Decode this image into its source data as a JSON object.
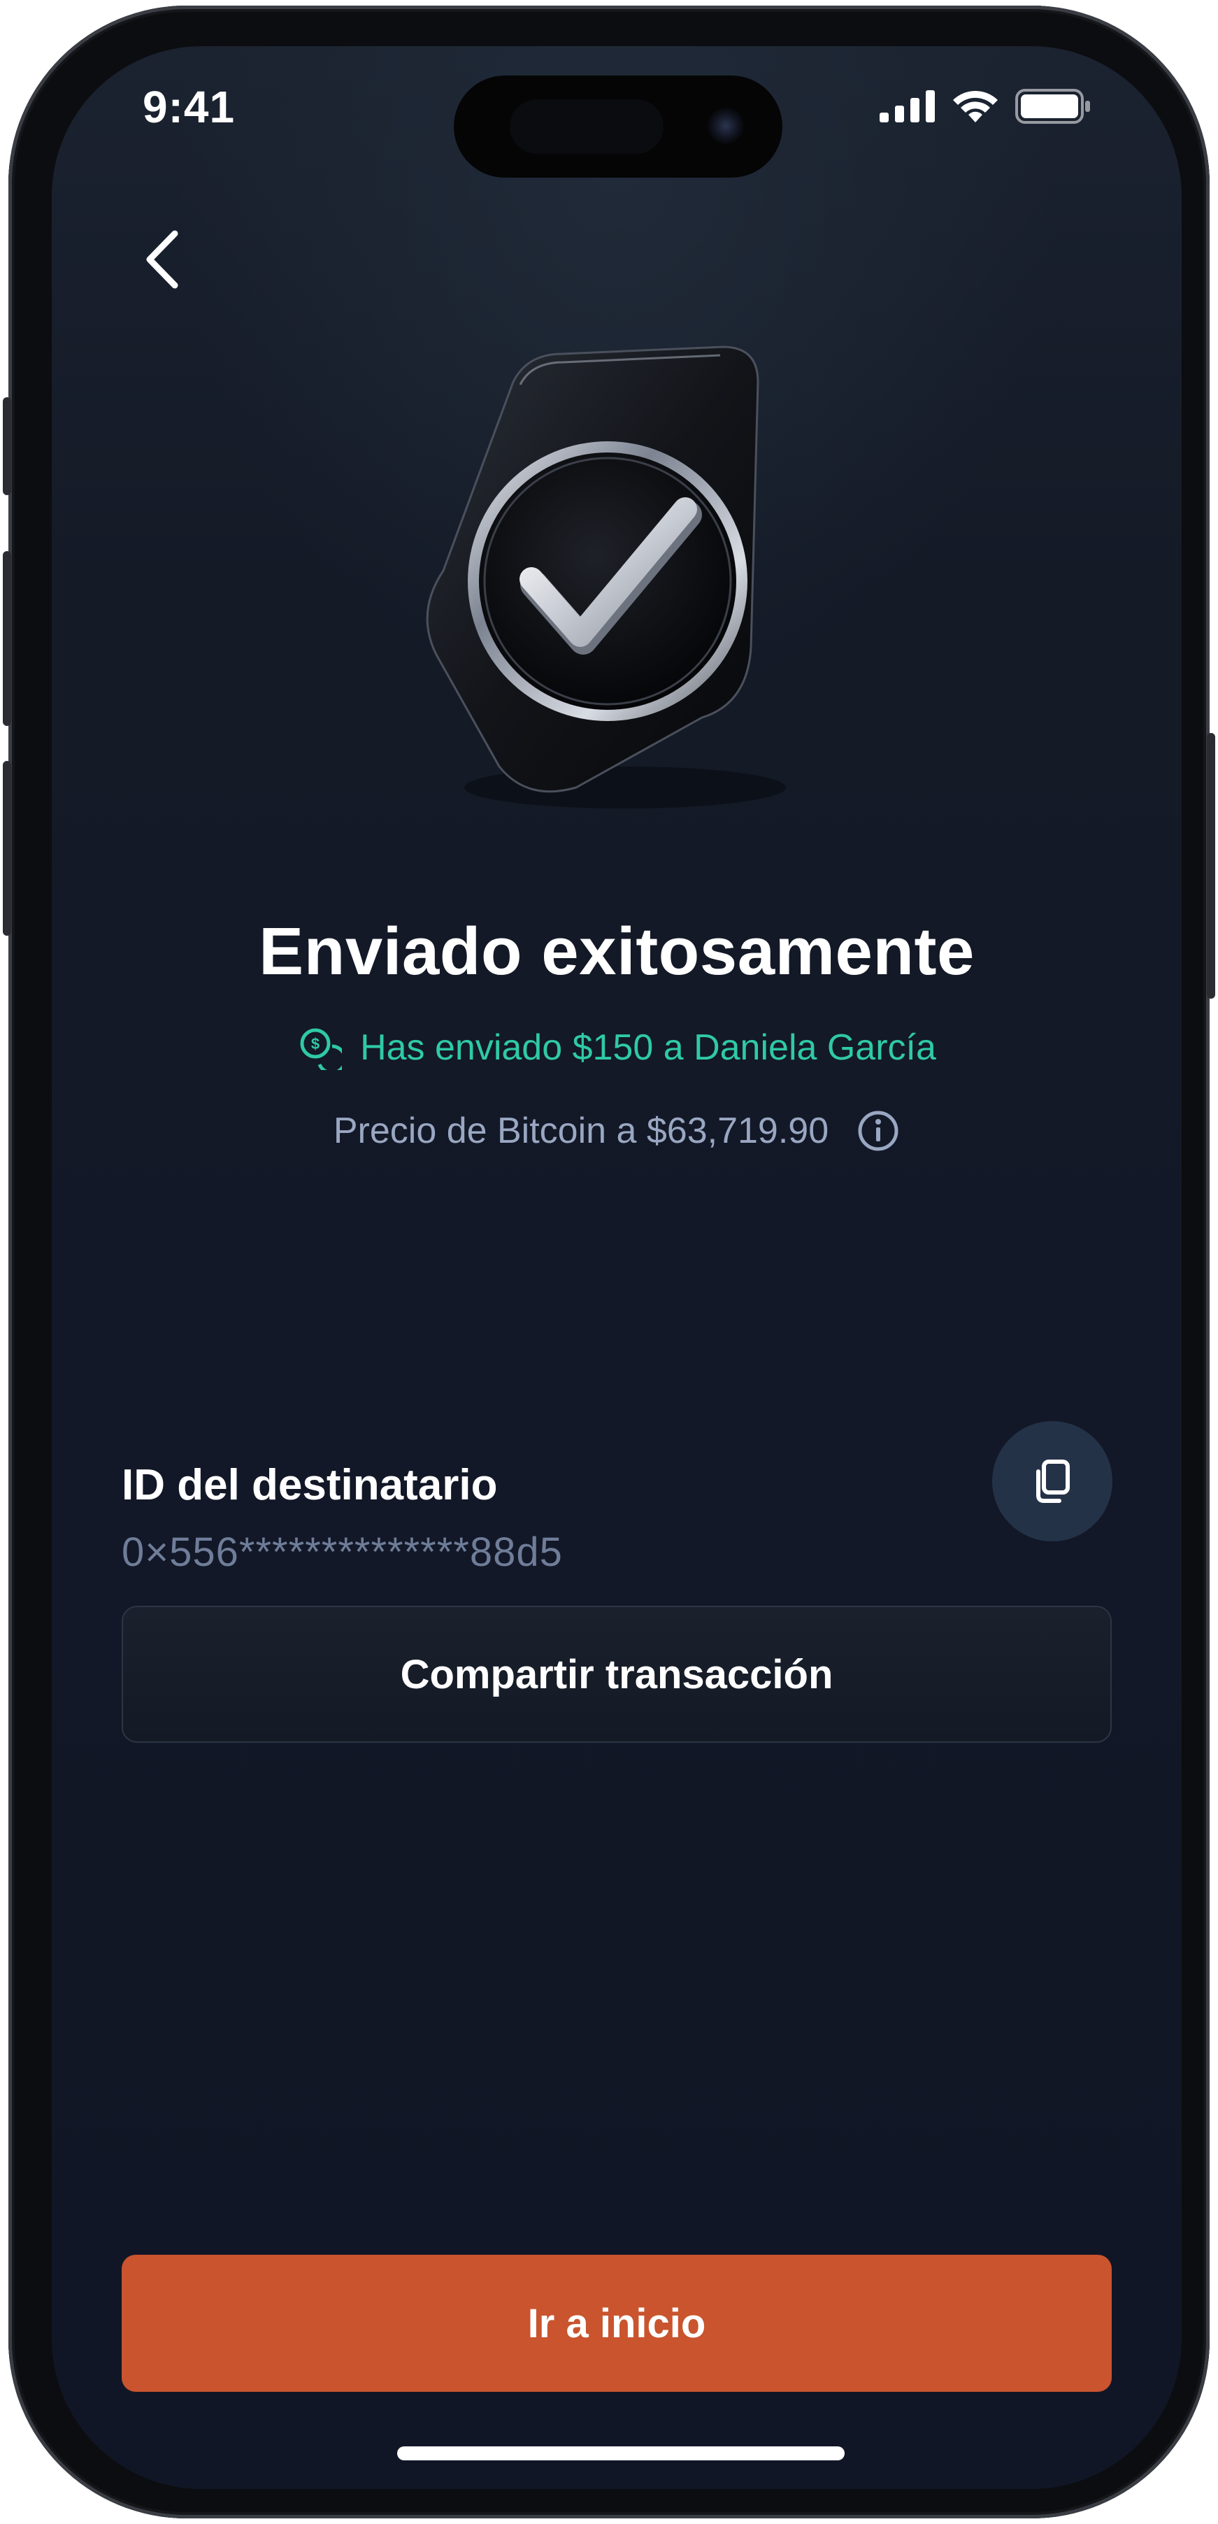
{
  "status_bar": {
    "time": "9:41"
  },
  "header": {
    "back_icon": "chevron-left-icon"
  },
  "hero": {
    "icon": "checkmark-badge-icon"
  },
  "confirmation": {
    "title": "Enviado exitosamente",
    "sent_message": "Has enviado $150 a Daniela García",
    "sent_icon": "coins-icon",
    "price_text": "Precio de Bitcoin a $63,719.90",
    "price_info_icon": "info-icon"
  },
  "recipient": {
    "label": "ID del destinatario",
    "id_value": "0×556**************88d5",
    "copy_icon": "copy-icon"
  },
  "actions": {
    "share_label": "Compartir transacción",
    "home_label": "Ir a inicio"
  },
  "colors": {
    "background": "#121827",
    "accent_green": "#2fc9a6",
    "primary_button": "#c9542e",
    "muted_text": "#9aa7c2"
  }
}
